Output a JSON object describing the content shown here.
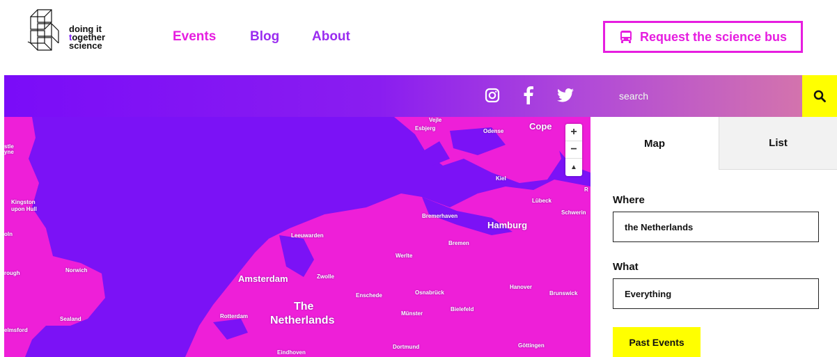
{
  "logo": {
    "line1": "doing it",
    "line2_t": "t",
    "line2_rest": "ogether",
    "line3": "science"
  },
  "nav": {
    "events": "Events",
    "blog": "Blog",
    "about": "About"
  },
  "bus_button": {
    "label": "Request the science bus"
  },
  "search": {
    "placeholder": "search"
  },
  "map": {
    "labels": {
      "esbjerg": "Esbjerg",
      "vejle": "Vejle",
      "odense": "Odense",
      "copenhagen": "Cope",
      "kiel": "Kiel",
      "lubeck": "Lübeck",
      "schwerin": "Schwerin",
      "r": "R",
      "bremerhaven": "Bremerhaven",
      "hamburg": "Hamburg",
      "bremen": "Bremen",
      "leeuwarden": "Leeuwarden",
      "werlte": "Werlte",
      "amsterdam": "Amsterdam",
      "zwolle": "Zwolle",
      "enschede": "Enschede",
      "osnabruck": "Osnabrück",
      "hanover": "Hanover",
      "brunswick": "Brunswick",
      "munster": "Münster",
      "bielefeld": "Bielefeld",
      "rotterdam": "Rotterdam",
      "the": "The",
      "netherlands": "Netherlands",
      "eindhoven": "Eindhoven",
      "dortmund": "Dortmund",
      "gottingen": "Göttingen",
      "kingston": "Kingston",
      "upon_hull": "upon Hull",
      "norwich": "Norwich",
      "sealand": "Sealand",
      "olin": "oln",
      "rough": "rough",
      "elmsford": "elmsford",
      "stle": "stle",
      "yne": "yne"
    },
    "zoom_in": "+",
    "zoom_out": "−",
    "reset": "▲"
  },
  "sidebar": {
    "tabs": {
      "map": "Map",
      "list": "List"
    },
    "where_label": "Where",
    "where_value": "the Netherlands",
    "what_label": "What",
    "what_value": "Everything",
    "past_button": "Past Events"
  },
  "colors": {
    "accent_magenta": "#e61de0",
    "accent_purple": "#7a0cf8",
    "yellow": "#ffff00"
  },
  "icons": [
    "instagram-icon",
    "facebook-icon",
    "twitter-icon",
    "search-icon",
    "bus-icon"
  ]
}
